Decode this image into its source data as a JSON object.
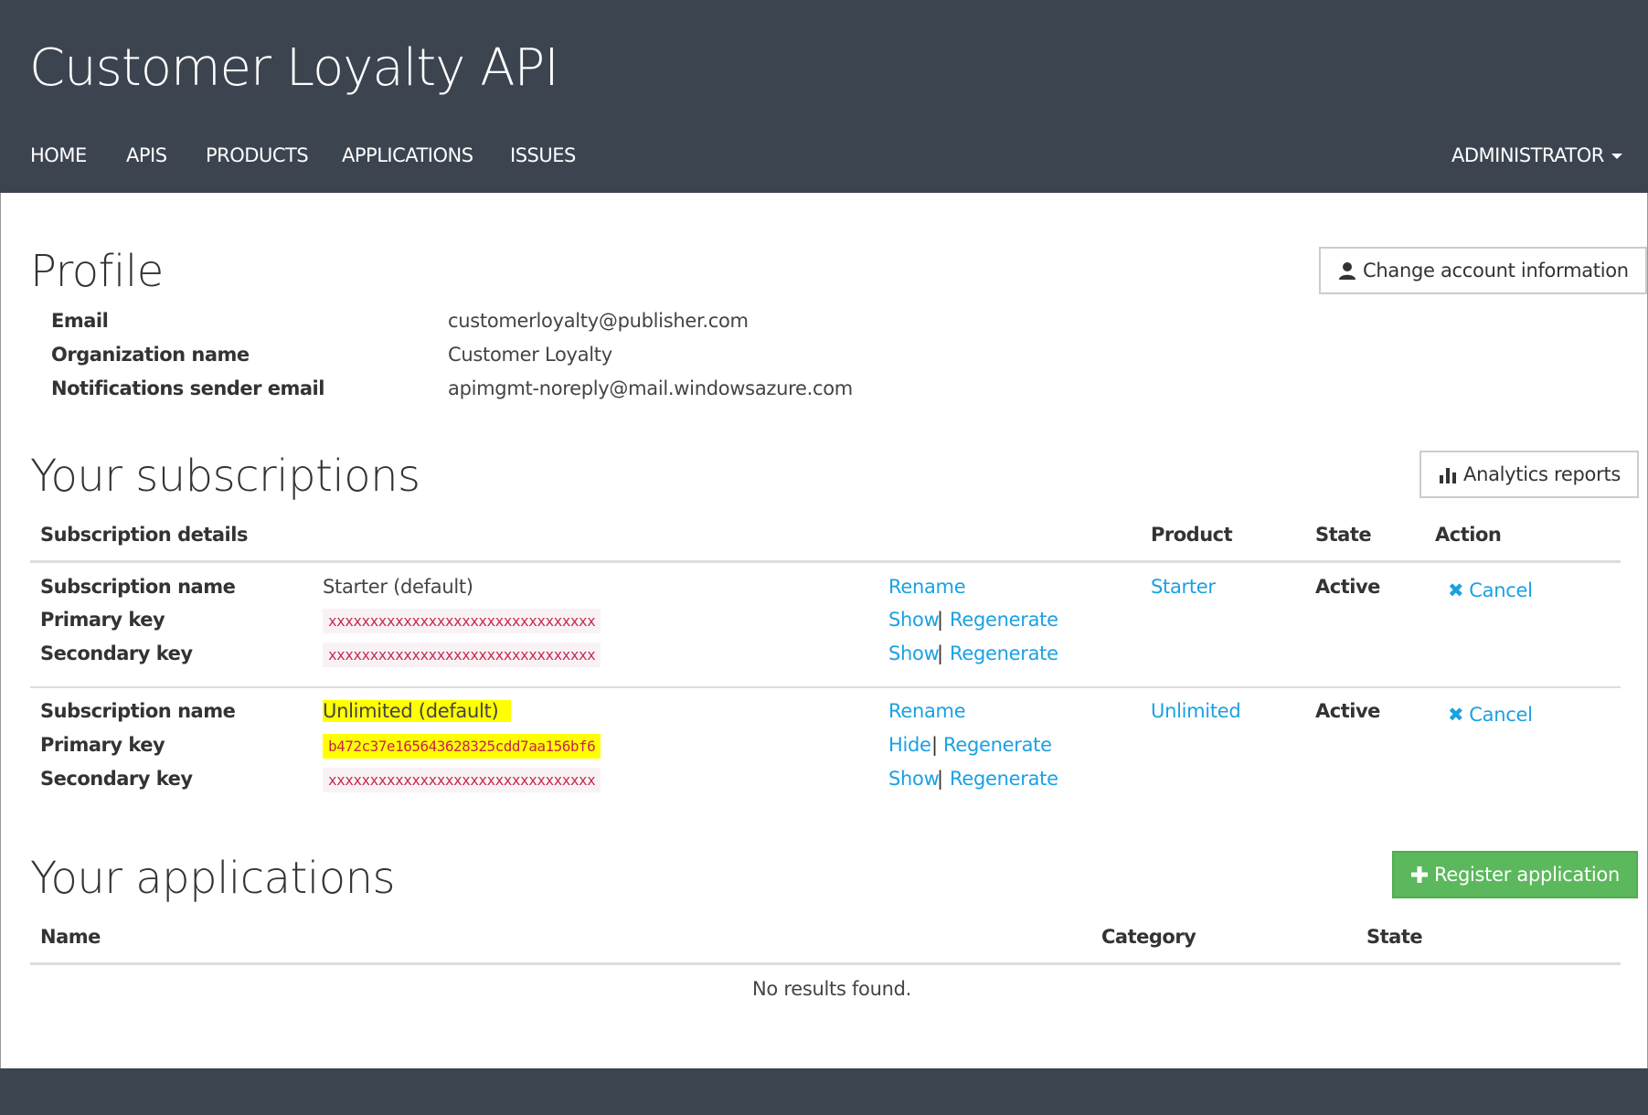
{
  "header": {
    "title": "Customer Loyalty API",
    "nav": [
      "HOME",
      "APIS",
      "PRODUCTS",
      "APPLICATIONS",
      "ISSUES"
    ],
    "user_menu": "ADMINISTRATOR"
  },
  "profile": {
    "heading": "Profile",
    "change_button": "Change account information",
    "fields": [
      {
        "label": "Email",
        "value": "customerloyalty@publisher.com"
      },
      {
        "label": "Organization name",
        "value": "Customer Loyalty"
      },
      {
        "label": "Notifications sender email",
        "value": "apimgmt-noreply@mail.windowsazure.com"
      }
    ]
  },
  "subscriptions": {
    "heading": "Your subscriptions",
    "analytics_button": "Analytics reports",
    "columns": {
      "details": "Subscription details",
      "product": "Product",
      "state": "State",
      "action": "Action"
    },
    "row_labels": {
      "name": "Subscription name",
      "primary": "Primary key",
      "secondary": "Secondary key"
    },
    "links": {
      "rename": "Rename",
      "show": "Show",
      "hide": "Hide",
      "regenerate": "Regenerate",
      "cancel": "Cancel",
      "separator": "|"
    },
    "items": [
      {
        "name": "Starter (default)",
        "primary_key": "xxxxxxxxxxxxxxxxxxxxxxxxxxxxxxxx",
        "secondary_key": "xxxxxxxxxxxxxxxxxxxxxxxxxxxxxxxx",
        "product": "Starter",
        "state": "Active"
      },
      {
        "name": "Unlimited (default)",
        "primary_key": "b472c37e165643628325cdd7aa156bf6",
        "secondary_key": "xxxxxxxxxxxxxxxxxxxxxxxxxxxxxxxx",
        "product": "Unlimited",
        "state": "Active"
      }
    ]
  },
  "applications": {
    "heading": "Your applications",
    "register_button": "Register application",
    "columns": {
      "name": "Name",
      "category": "Category",
      "state": "State"
    },
    "empty_text": "No results found."
  },
  "colors": {
    "header_bg": "#3c4450",
    "link": "#1ba1e2",
    "green_button": "#5cb85c",
    "highlight": "#ffff00",
    "key_text": "#c7254e"
  }
}
